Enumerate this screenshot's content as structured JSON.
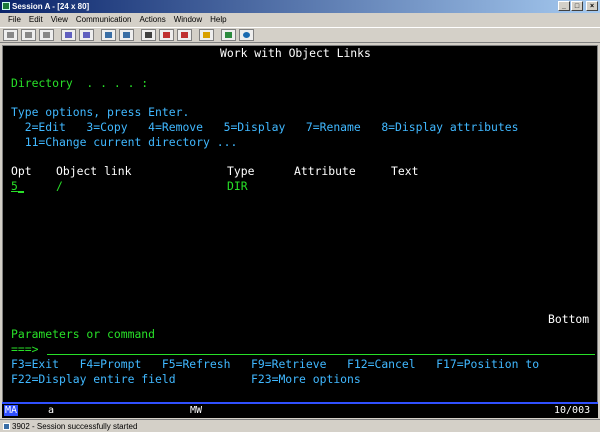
{
  "window": {
    "title": "Session A - [24 x 80]",
    "buttons": {
      "minimize": "_",
      "maximize": "□",
      "close": "×"
    }
  },
  "menu": [
    "File",
    "Edit",
    "View",
    "Communication",
    "Actions",
    "Window",
    "Help"
  ],
  "toolbar_icons": [
    "print-icon",
    "copy-icon",
    "paste-icon",
    "send-icon",
    "receive-icon",
    "display-icon",
    "record-icon",
    "macro-icon",
    "stop-icon",
    "color-icon",
    "globe-icon",
    "info-icon"
  ],
  "screen": {
    "title": "Work with Object Links",
    "directory_label": "Directory  . . . . :",
    "instructions": "Type options, press Enter.",
    "options_line1": "  2=Edit   3=Copy   4=Remove   5=Display   7=Rename   8=Display attributes",
    "options_line2": "  11=Change current directory ...",
    "columns": {
      "opt": "Opt",
      "object_link": "Object link",
      "type": "Type",
      "attribute": "Attribute",
      "text": "Text"
    },
    "rows": [
      {
        "opt": "5",
        "object_link": "/",
        "type": "DIR",
        "attribute": "",
        "text": ""
      }
    ],
    "bottom": "Bottom",
    "params_label": "Parameters or command",
    "prompt": "===>",
    "fkeys_line1": "F3=Exit   F4=Prompt   F5=Refresh   F9=Retrieve   F12=Cancel   F17=Position to",
    "fkeys_line2": "F22=Display entire field           F23=More options"
  },
  "oia": {
    "ma": "MA",
    "a": "a",
    "mw": "MW",
    "pos": "10/003"
  },
  "status": {
    "message": "3902 - Session successfully started"
  }
}
